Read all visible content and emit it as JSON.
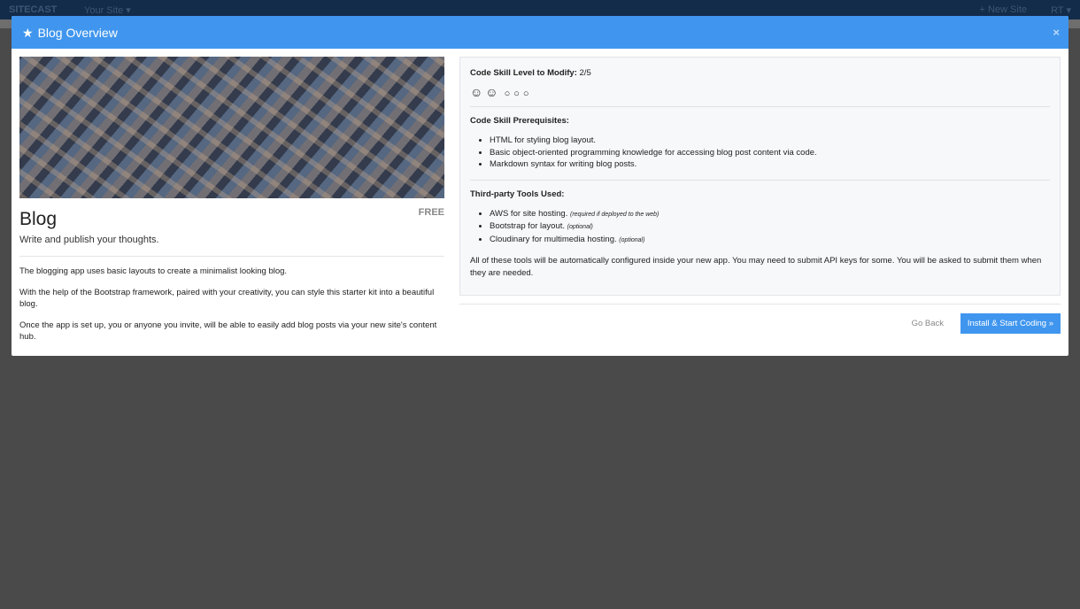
{
  "navbar": {
    "brand": "SITECAST",
    "site_menu": "Your Site ▾",
    "new_site": "+ New Site",
    "user": "RT ▾"
  },
  "modal": {
    "title": "Blog Overview",
    "close": "×",
    "app": {
      "name": "Blog",
      "price": "FREE",
      "tagline": "Write and publish your thoughts.",
      "description": [
        "The blogging app uses basic layouts to create a minimalist looking blog.",
        "With the help of the Bootstrap framework, paired with your creativity, you can style this starter kit into a beautiful blog.",
        "Once the app is set up, you or anyone you invite, will be able to easily add blog posts via your new site's content hub."
      ]
    },
    "skill": {
      "label": "Code Skill Level to Modify:",
      "value": "2/5",
      "level": 2,
      "max": 5
    },
    "prereq": {
      "heading": "Code Skill Prerequisites:",
      "items": [
        "HTML for styling blog layout.",
        "Basic object-oriented programming knowledge for accessing blog post content via code.",
        "Markdown syntax for writing blog posts."
      ]
    },
    "tools": {
      "heading": "Third-party Tools Used:",
      "items": [
        {
          "text": "AWS for site hosting.",
          "note": "(required if deployed to the web)"
        },
        {
          "text": "Bootstrap for layout.",
          "note": "(optional)"
        },
        {
          "text": "Cloudinary for multimedia hosting.",
          "note": "(optional)"
        }
      ]
    },
    "note": "All of these tools will be automatically configured inside your new app. You may need to submit API keys for some. You will be asked to submit them when they are needed.",
    "go_back": "Go Back",
    "install": "Install & Start Coding »"
  },
  "colors": {
    "accent": "#4096ee",
    "navbar": "#132c4a",
    "backdrop": "#4a4a4a"
  }
}
